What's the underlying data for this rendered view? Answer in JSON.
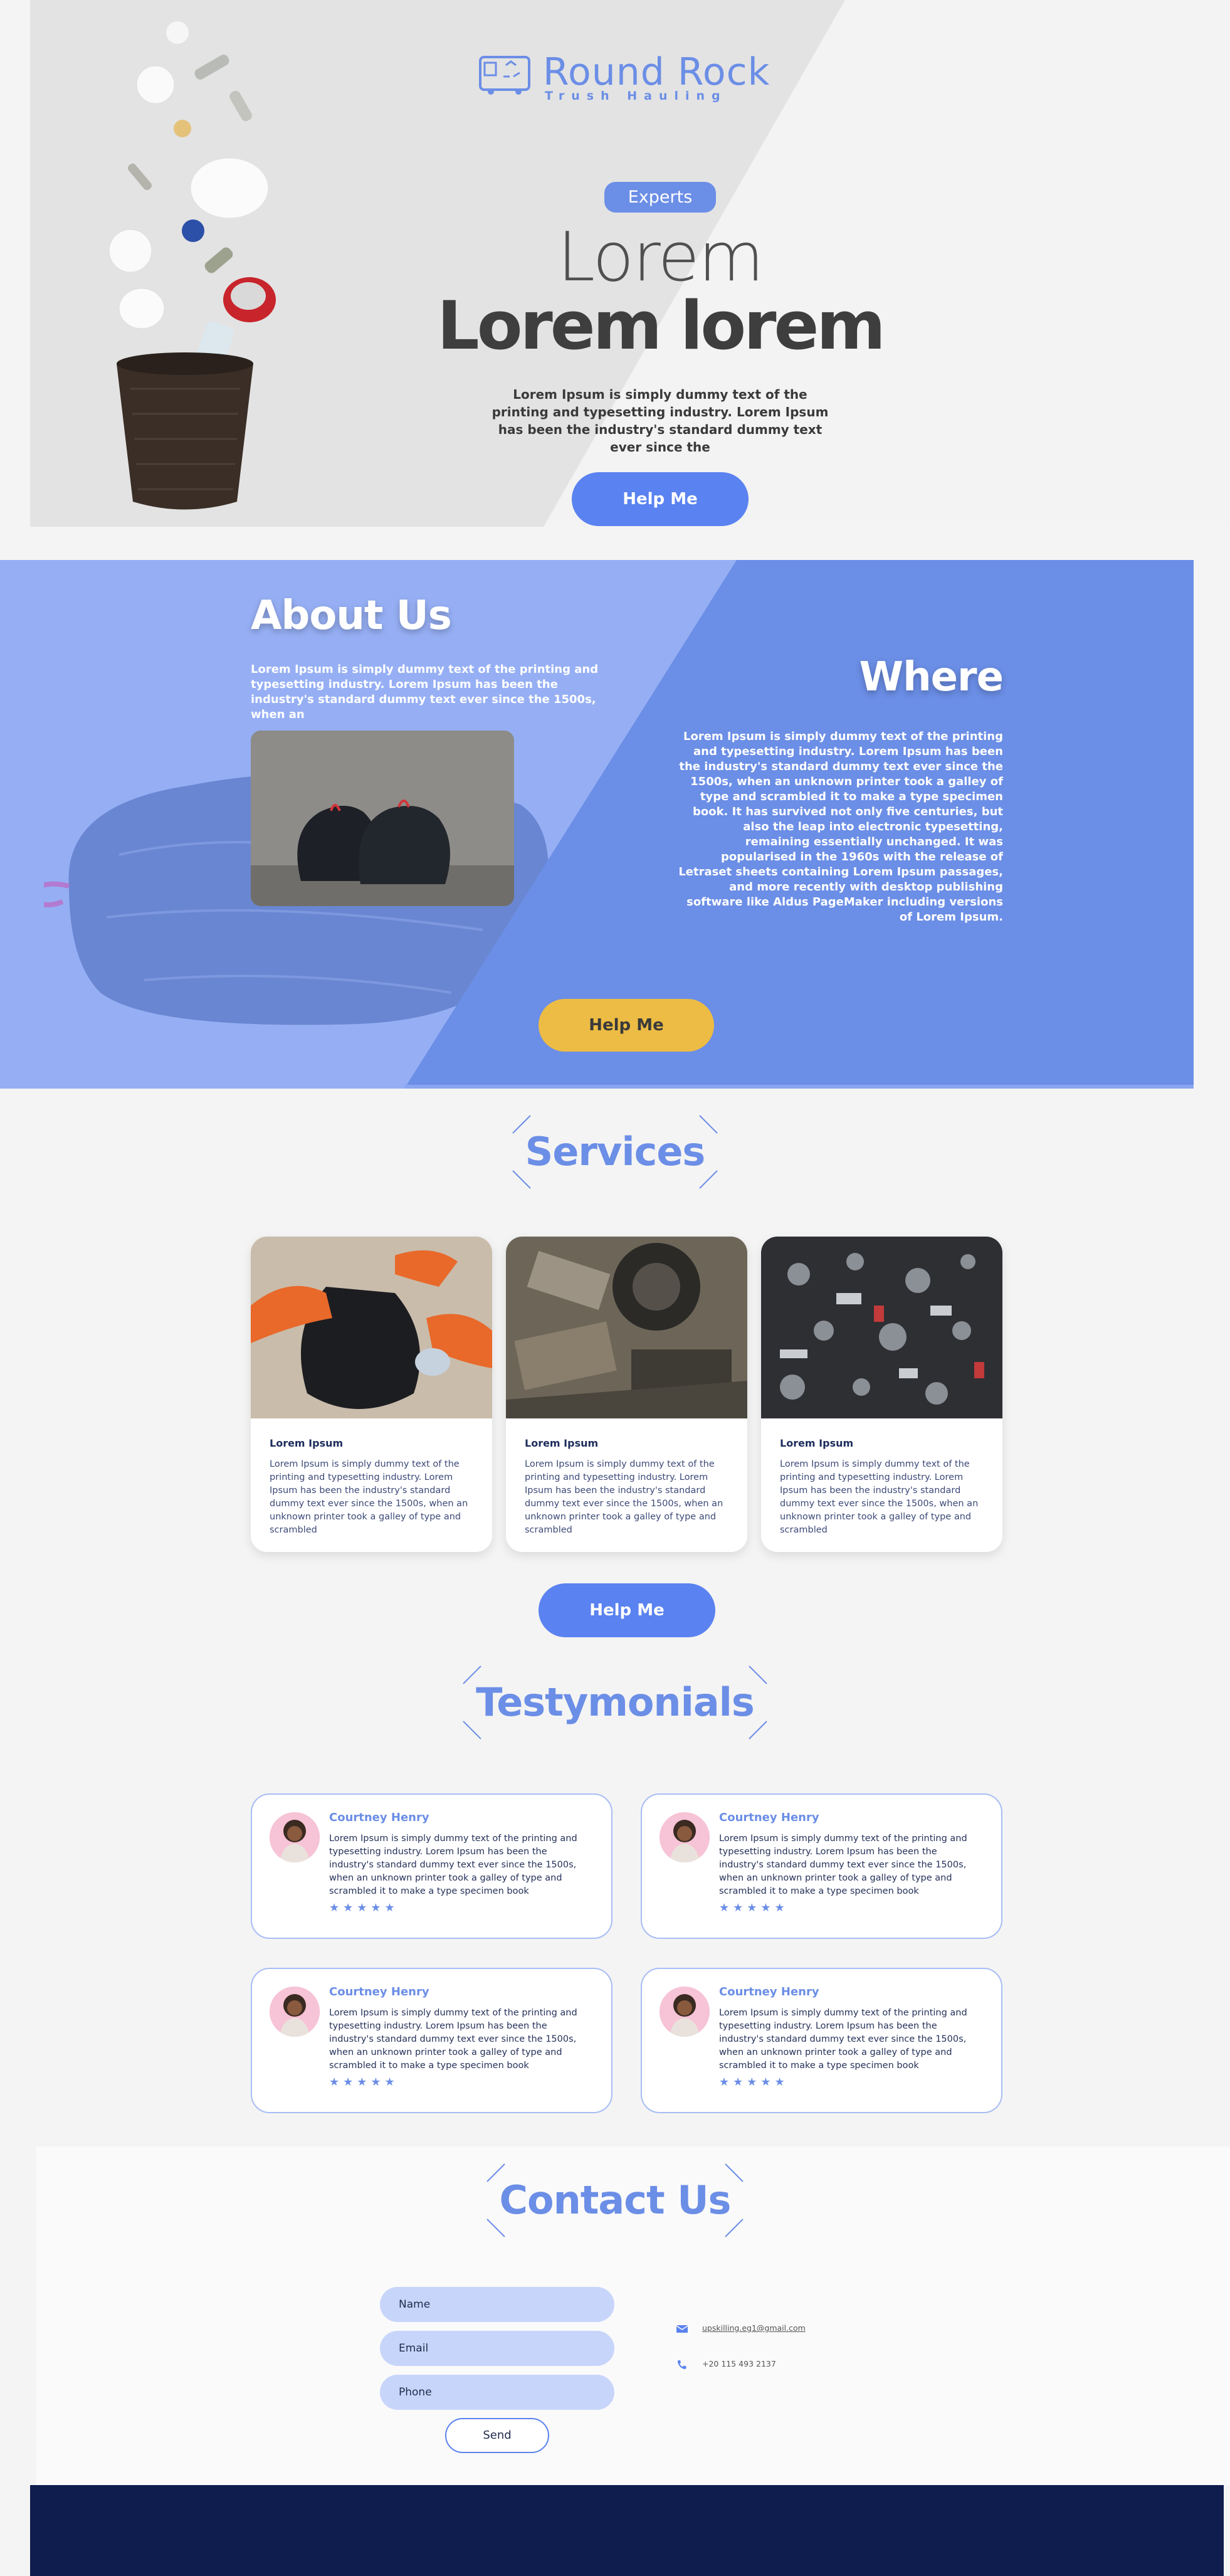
{
  "brand": {
    "name": "Round Rock",
    "tagline": "Trush Hauling"
  },
  "hero": {
    "badge": "Experts",
    "line1": "Lorem",
    "line2": "Lorem lorem",
    "text": "Lorem Ipsum is simply dummy text of the printing and typesetting industry. Lorem Ipsum has been the industry's standard dummy text ever since the",
    "button": "Help Me"
  },
  "about": {
    "title": "About Us",
    "text": "Lorem Ipsum is simply dummy text of the printing and typesetting industry. Lorem Ipsum has been the industry's standard dummy text ever since the 1500s, when an",
    "where_title": "Where",
    "where_text": "Lorem Ipsum is simply dummy text of the printing and typesetting industry. Lorem Ipsum has been the industry's standard dummy text ever since the 1500s, when an unknown printer took a galley of type and scrambled it to make a type specimen book. It has survived not only five centuries, but also the leap into electronic typesetting, remaining essentially unchanged. It was popularised in the 1960s with the release of Letraset sheets containing Lorem Ipsum passages, and more recently with desktop publishing software like Aldus PageMaker including versions of Lorem Ipsum.",
    "button": "Help Me"
  },
  "services": {
    "title": "Services",
    "cards": [
      {
        "title": "Lorem Ipsum",
        "text": "Lorem Ipsum is simply dummy text of the printing and typesetting industry. Lorem Ipsum has been the industry's standard dummy text ever since the 1500s, when an unknown printer took a galley of type and scrambled"
      },
      {
        "title": "Lorem Ipsum",
        "text": "Lorem Ipsum is simply dummy text of the printing and typesetting industry. Lorem Ipsum has been the industry's standard dummy text ever since the 1500s, when an unknown printer took a galley of type and scrambled"
      },
      {
        "title": "Lorem Ipsum",
        "text": "Lorem Ipsum is simply dummy text of the printing and typesetting industry. Lorem Ipsum has been the industry's standard dummy text ever since the 1500s, when an unknown printer took a galley of type and scrambled"
      }
    ],
    "button": "Help Me"
  },
  "testimonials": {
    "title": "Testymonials",
    "items": [
      {
        "name": "Courtney Henry",
        "text": "Lorem Ipsum is simply dummy text of the printing and typesetting industry. Lorem Ipsum has been the industry's standard dummy text ever since the 1500s, when an unknown printer took a galley of type and scrambled it to make a type specimen book",
        "stars": 5,
        "stars_text": "★★★★★"
      },
      {
        "name": "Courtney Henry",
        "text": "Lorem Ipsum is simply dummy text of the printing and typesetting industry. Lorem Ipsum has been the industry's standard dummy text ever since the 1500s, when an unknown printer took a galley of type and scrambled it to make a type specimen book",
        "stars": 5,
        "stars_text": "★★★★★"
      },
      {
        "name": "Courtney Henry",
        "text": "Lorem Ipsum is simply dummy text of the printing and typesetting industry. Lorem Ipsum has been the industry's standard dummy text ever since the 1500s, when an unknown printer took a galley of type and scrambled it to make a type specimen book",
        "stars": 5,
        "stars_text": "★★★★★"
      },
      {
        "name": "Courtney Henry",
        "text": "Lorem Ipsum is simply dummy text of the printing and typesetting industry. Lorem Ipsum has been the industry's standard dummy text ever since the 1500s, when an unknown printer took a galley of type and scrambled it to make a type specimen book",
        "stars": 5,
        "stars_text": "★★★★★"
      }
    ]
  },
  "contact": {
    "title": "Contact Us",
    "fields": {
      "name": "Name",
      "email": "Email",
      "phone": "Phone"
    },
    "send": "Send",
    "email": "upskilling.eg1@gmail.com",
    "phone": "+20 115 493 2137"
  },
  "colors": {
    "accent": "#6b8ee6",
    "button": "#5a82f0",
    "yellow": "#edbc44",
    "footer": "#0e1c4e",
    "about_light": "#96aff4"
  },
  "icons": [
    "recycle-truck-icon",
    "mail-icon",
    "phone-icon",
    "star-icon"
  ]
}
